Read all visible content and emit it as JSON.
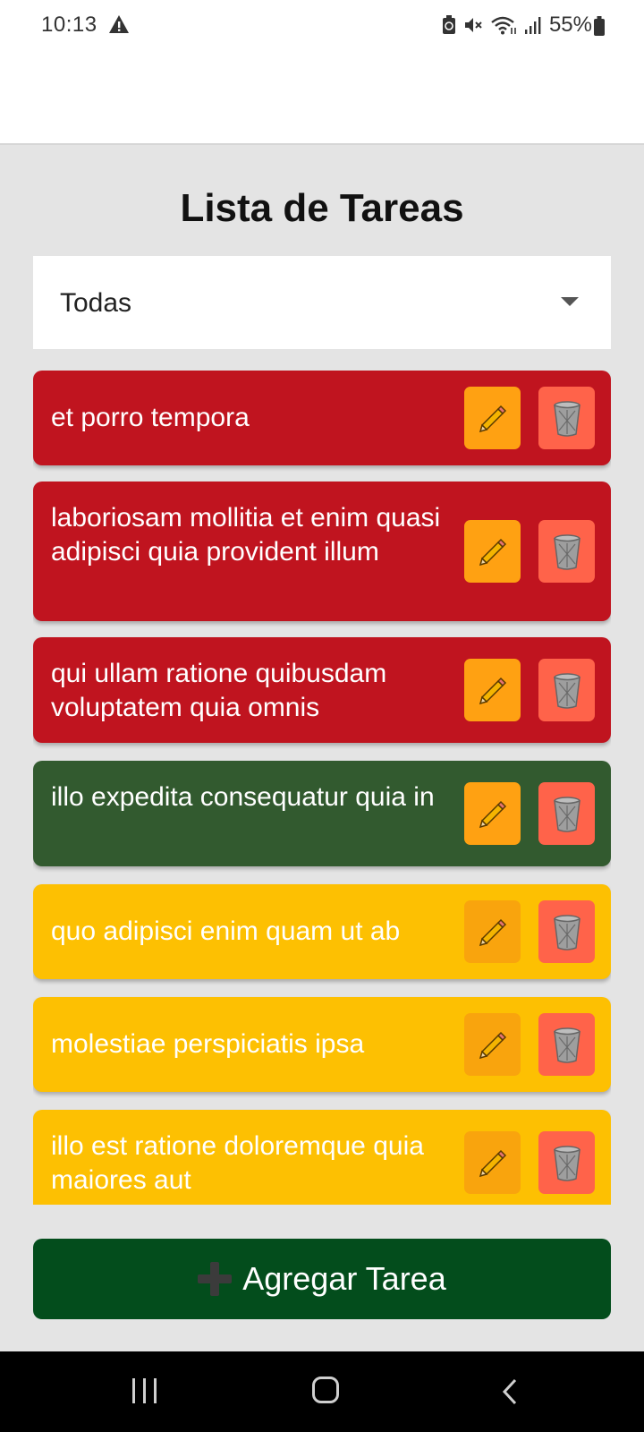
{
  "status_bar": {
    "time": "10:13",
    "battery": "55%"
  },
  "title": "Lista de Tareas",
  "filter": {
    "selected": "Todas"
  },
  "colors": {
    "pending": "#c0141f",
    "done": "#325a2f",
    "in_progress": "#fdc002",
    "add_button": "#034d1c"
  },
  "tasks": [
    {
      "text": "et porro tempora",
      "color": "red",
      "edit_icon": "pencil-icon",
      "delete_icon": "trash-icon"
    },
    {
      "text": "laboriosam mollitia et enim quasi adipisci quia provident illum",
      "color": "red",
      "edit_icon": "pencil-icon",
      "delete_icon": "trash-icon"
    },
    {
      "text": "qui ullam ratione quibusdam voluptatem quia omnis",
      "color": "red",
      "edit_icon": "pencil-icon",
      "delete_icon": "trash-icon"
    },
    {
      "text": "illo expedita consequatur quia in",
      "color": "green",
      "edit_icon": "pencil-icon",
      "delete_icon": "trash-icon"
    },
    {
      "text": "quo adipisci enim quam ut ab",
      "color": "yellow",
      "edit_icon": "pencil-icon",
      "delete_icon": "trash-icon"
    },
    {
      "text": "molestiae perspiciatis ipsa",
      "color": "yellow",
      "edit_icon": "pencil-icon",
      "delete_icon": "trash-icon"
    },
    {
      "text": "illo est ratione doloremque quia maiores aut",
      "color": "yellow",
      "edit_icon": "pencil-icon",
      "delete_icon": "trash-icon"
    }
  ],
  "add_button": {
    "label": "Agregar Tarea",
    "icon": "plus-icon"
  }
}
